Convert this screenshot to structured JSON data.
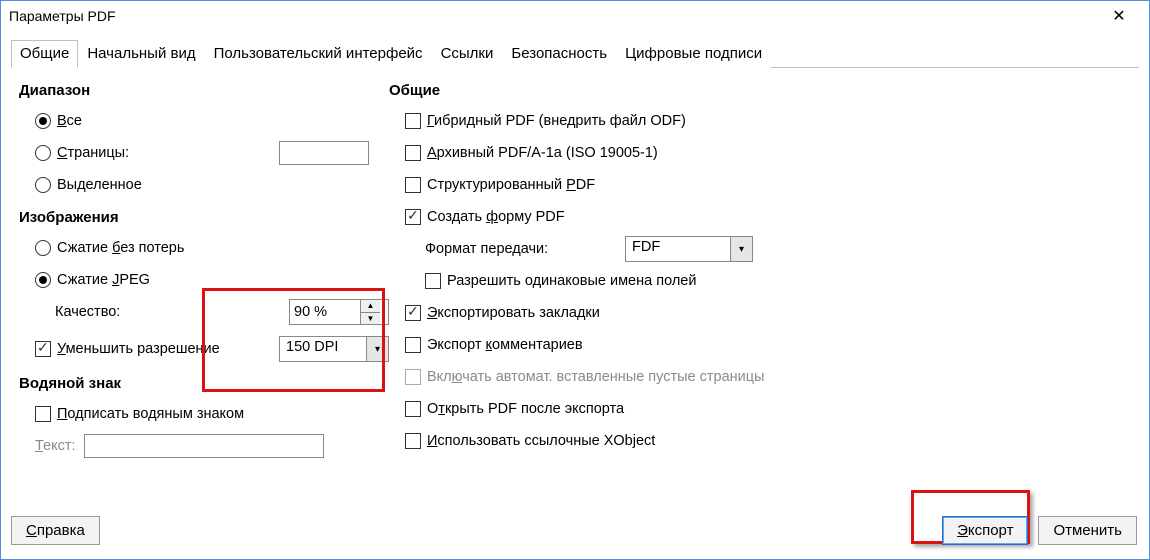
{
  "window": {
    "title": "Параметры PDF"
  },
  "tabs": {
    "general": "Общие",
    "initial_view": "Начальный вид",
    "ui": "Пользовательский интерфейс",
    "links": "Ссылки",
    "security": "Безопасность",
    "signatures": "Цифровые подписи"
  },
  "left": {
    "range_title": "Диапазон",
    "all": "Все",
    "pages": "Страницы:",
    "selection": "Выделенное",
    "images_title": "Изображения",
    "lossless": "Сжатие без потерь",
    "jpeg": "Сжатие JPEG",
    "quality_label": "Качество:",
    "quality_value": "90 %",
    "reduce_res": "Уменьшить разрешение",
    "dpi_value": "150 DPI",
    "watermark_title": "Водяной знак",
    "sign_wm": "Подписать водяным знаком",
    "text_label": "Текст:"
  },
  "right": {
    "general_title": "Общие",
    "hybrid": "Гибридный PDF (внедрить файл ODF)",
    "archive": "Архивный PDF/A-1a (ISO 19005-1)",
    "tagged": "Структурированный PDF",
    "create_form": "Создать форму PDF",
    "submit_format_label": "Формат передачи:",
    "submit_format_value": "FDF",
    "dup_names": "Разрешить одинаковые имена полей",
    "bookmarks": "Экспортировать закладки",
    "comments": "Экспорт комментариев",
    "auto_blank": "Включать автомат. вставленные пустые страницы",
    "view_after": "Открыть PDF после экспорта",
    "ref_xobject": "Использовать ссылочные XObject"
  },
  "buttons": {
    "help": "Справка",
    "export": "Экспорт",
    "cancel": "Отменить"
  }
}
